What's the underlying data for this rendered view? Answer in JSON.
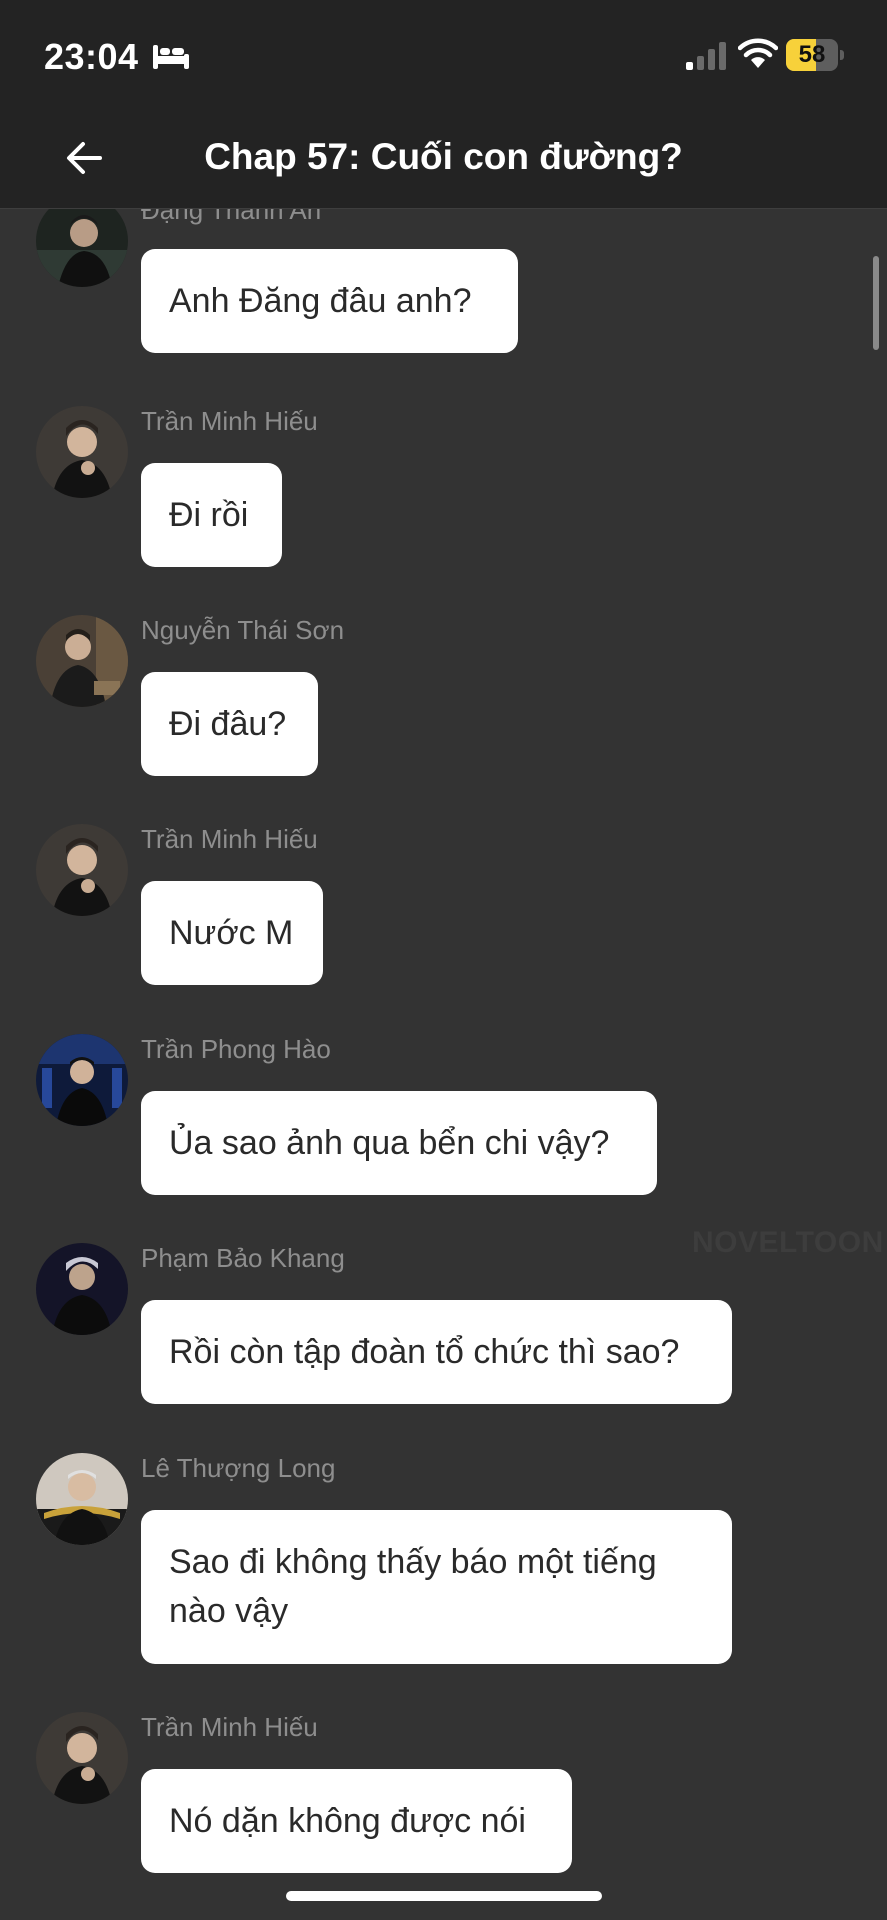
{
  "status_bar": {
    "time": "23:04",
    "battery_level": "58",
    "battery_fraction": 0.58,
    "icons": [
      "bed-icon",
      "cellular-signal-icon",
      "wifi-icon",
      "battery-icon"
    ]
  },
  "header": {
    "title": "Chap 57: Cuối con đường?",
    "back_icon": "arrow-left-icon"
  },
  "watermark": "NOVELTOON",
  "messages": [
    {
      "sender": "Đặng Thành An",
      "text": "Anh Đăng đâu anh?"
    },
    {
      "sender": "Trần Minh Hiếu",
      "text": "Đi rồi"
    },
    {
      "sender": "Nguyễn Thái Sơn",
      "text": "Đi đâu?"
    },
    {
      "sender": "Trần Minh Hiếu",
      "text": "Nước M"
    },
    {
      "sender": "Trần Phong Hào",
      "text": "Ủa sao ảnh qua bển chi vậy?"
    },
    {
      "sender": "Phạm Bảo Khang",
      "text": "Rồi còn tập đoàn tổ chức thì sao?"
    },
    {
      "sender": "Lê Thượng Long",
      "text": "Sao đi không thấy báo một tiếng\nnào vậy"
    },
    {
      "sender": "Trần Minh Hiếu",
      "text": "Nó dặn không được nói"
    }
  ],
  "colors": {
    "background": "#333333",
    "header_background": "#232323",
    "bubble": "#ffffff",
    "sender_text": "#8e8e8e",
    "battery_accent": "#f7d13a"
  }
}
